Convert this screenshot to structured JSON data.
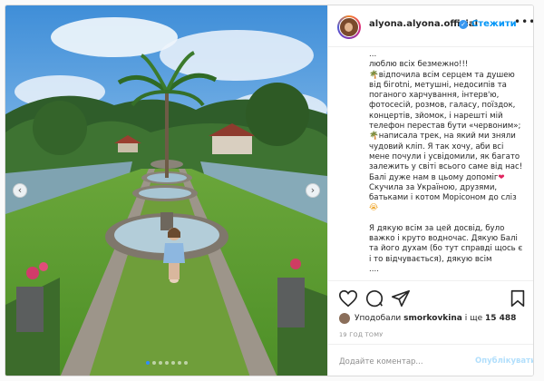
{
  "header": {
    "username": "alyona.alyona.official",
    "follow_label": "Стежити",
    "more_label": "•••"
  },
  "caption": {
    "lines": [
      "...",
      "люблю всіх безмежно!!!",
      "[palm] відпочила всім серцем та душею",
      "від бігotni, метушні, недосипів та",
      "поганого харчування, інтерв'ю,",
      "фотосесій, розмов, галасу, поїздок,",
      "концертів, зйомок, і нарешті мій",
      "телефон перестав бути «червоним»;",
      "[palm] написала трек, на який ми зняли",
      "чудовий кліп. Я так хочу, аби всі",
      "мене почули і усвідомили, як багато",
      "залежить у світі всього саме від нас!",
      "Балі дуже нам в цьому допоміг[heart]",
      "Скучила за Україною, друзями,",
      "батьками і котом Морісоном до сліз",
      "[cry]",
      "",
      "Я дякую всім за цей досвід, було",
      "важко і круто водночас. Дякую Балі",
      "та його духам (бо тут справді щось є",
      "і то відчувається), дякую всім",
      "...."
    ]
  },
  "likes": {
    "prefix": "Уподобали",
    "user": "smorkovkina",
    "middle": "і ще",
    "count": "15 488"
  },
  "time_label": "19 ГОД ТОМУ",
  "comment": {
    "placeholder": "Додайте коментар...",
    "publish_label": "Опублікувати"
  },
  "carousel": {
    "dot_count": 7,
    "active_index": 0
  },
  "colors": {
    "link": "#0095f6",
    "publish_disabled": "#b2dffc",
    "verified": "#3897f0"
  },
  "icons": {
    "like": "heart-icon",
    "comment": "comment-icon",
    "share": "paper-plane-icon",
    "save": "bookmark-icon",
    "prev": "chevron-left-icon",
    "next": "chevron-right-icon"
  }
}
